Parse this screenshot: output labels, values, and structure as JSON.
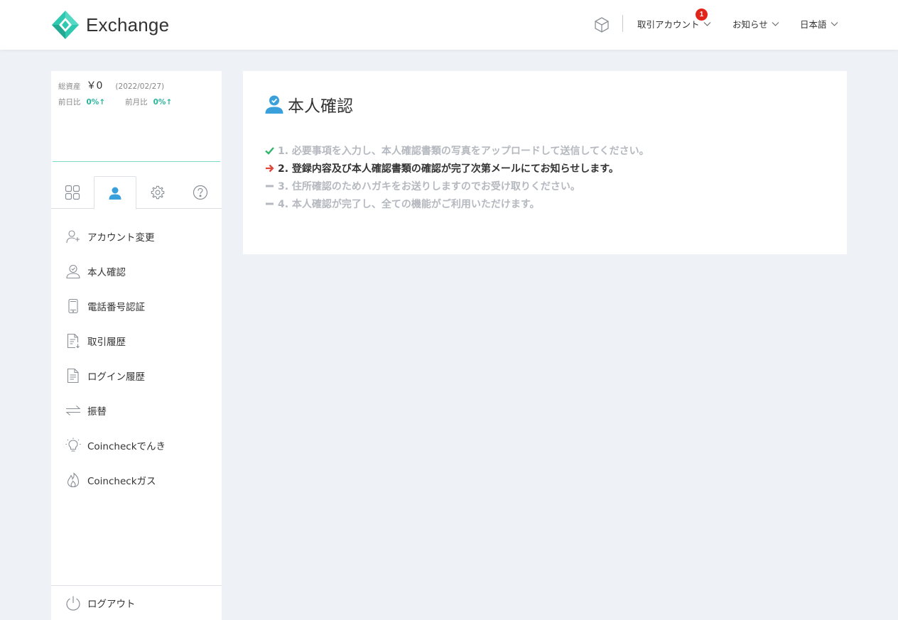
{
  "header": {
    "logo_text": "Exchange",
    "nav": [
      {
        "label": "取引アカウント"
      },
      {
        "label": "お知らせ"
      },
      {
        "label": "日本語"
      }
    ],
    "notification_count": "1",
    "accent_color": "#2fc8b0"
  },
  "sidebar": {
    "assets": {
      "total_label": "総資産",
      "total_value": "￥0",
      "date": "(2022/02/27)",
      "day_label": "前日比",
      "day_value": "0%↑",
      "month_label": "前月比",
      "month_value": "0%↑"
    },
    "tabs": [
      {
        "icon": "grid-icon"
      },
      {
        "icon": "user-icon",
        "active": true
      },
      {
        "icon": "gear-icon"
      },
      {
        "icon": "help-icon"
      }
    ],
    "menu": [
      {
        "label": "アカウント変更",
        "icon": "user-add-icon"
      },
      {
        "label": "本人確認",
        "icon": "user-check-icon"
      },
      {
        "label": "電話番号認証",
        "icon": "phone-icon"
      },
      {
        "label": "取引履歴",
        "icon": "document-download-icon"
      },
      {
        "label": "ログイン履歴",
        "icon": "document-icon"
      },
      {
        "label": "振替",
        "icon": "transfer-icon"
      },
      {
        "label": "Coincheckでんき",
        "icon": "lightbulb-icon"
      },
      {
        "label": "Coincheckガス",
        "icon": "flame-icon"
      }
    ],
    "logout_label": "ログアウト"
  },
  "main": {
    "title": "本人確認",
    "steps": [
      {
        "text": "1. 必要事項を入力し、本人確認書類の写真をアップロードして送信してください。",
        "status": "done"
      },
      {
        "text": "2. 登録内容及び本人確認書類の確認が完了次第メールにてお知らせします。",
        "status": "current"
      },
      {
        "text": "3. 住所確認のためハガキをお送りしますのでお受け取りください。",
        "status": "todo"
      },
      {
        "text": "4. 本人確認が完了し、全ての機能がご利用いただけます。",
        "status": "todo"
      }
    ],
    "colors": {
      "done": "#2fb56a",
      "current": "#e0473a",
      "todo": "#b5b9bf"
    }
  }
}
